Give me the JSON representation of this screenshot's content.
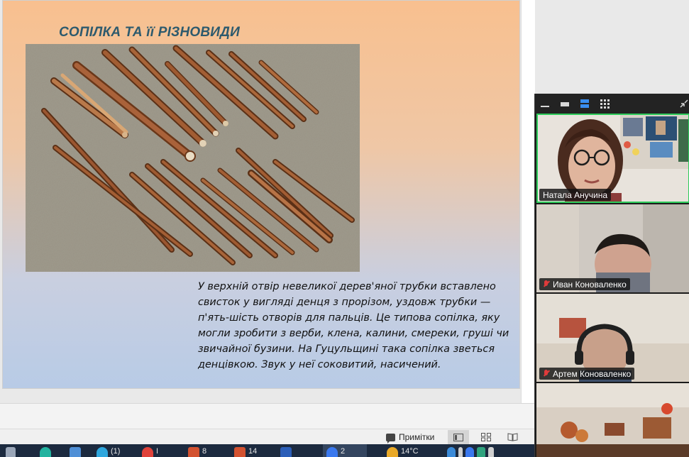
{
  "slide": {
    "title": "СОПІЛКА ТА її РІЗНОВИДИ",
    "body": "У верхній отвір невеликої дерев'яної трубки вставлено свисток у вигляді денця з прорізом, уздовж трубки — п'ять-шість отворів для пальців. Це типова сопілка, яку могли зробити з верби, клена, калини, смереки, груші чи звичайної бузини. На Гуцульщині така сопілка зветься денцівкою. Звук у неї соковитий, насичений.",
    "photo_icon": "wooden-flutes-photo"
  },
  "statusbar": {
    "notes_label": "Примітки"
  },
  "conference": {
    "participants": [
      {
        "name": "Натала Анучина",
        "muted": false,
        "speaking": true
      },
      {
        "name": "Иван Коноваленко",
        "muted": true,
        "speaking": false
      },
      {
        "name": "Артем Коноваленко",
        "muted": true,
        "speaking": false
      },
      {
        "name": "",
        "muted": false,
        "speaking": false
      }
    ]
  },
  "taskbar": {
    "items": [
      "",
      "",
      "(1)",
      "I",
      "8",
      "14",
      "",
      "2",
      "14°C"
    ]
  },
  "colors": {
    "title": "#2d5a6d",
    "speaking_border": "#2ecc5b",
    "muted": "#e03b3b",
    "taskbar": "#1c2a3f"
  }
}
